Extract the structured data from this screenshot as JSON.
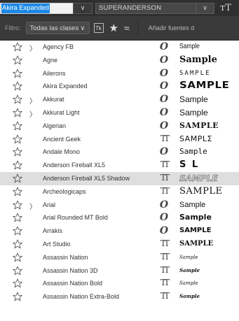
{
  "topbar": {
    "font_name": "Akira Expanded",
    "font_dd_icon": "chevron-down-icon",
    "style_value": "SUPERANDERSON",
    "style_dd_icon": "chevron-down-icon",
    "size_icon": "font-size-icon",
    "dd_glyph": "∨",
    "size_glyph": "тT"
  },
  "filter": {
    "label": "Filtro:",
    "select_value": "Todas las clases",
    "select_glyph": "∨",
    "tk_label": "Tk",
    "star_glyph": "★",
    "approx_glyph": "≈",
    "add_fonts_text": "Añadir fuentes d"
  },
  "fonts": [
    {
      "name": "Agency FB",
      "expandable": true,
      "type": "ot",
      "sample": "Sample"
    },
    {
      "name": "Agne",
      "expandable": false,
      "type": "ot",
      "sample": "Sample"
    },
    {
      "name": "Ailerons",
      "expandable": false,
      "type": "ot",
      "sample": "SAMPLE"
    },
    {
      "name": "Akira Expanded",
      "expandable": false,
      "type": "ot",
      "sample": "SAMPLE"
    },
    {
      "name": "Akkurat",
      "expandable": true,
      "type": "ot",
      "sample": "Sample"
    },
    {
      "name": "Akkurat Light",
      "expandable": true,
      "type": "ot",
      "sample": "Sample"
    },
    {
      "name": "Algerian",
      "expandable": false,
      "type": "ot",
      "sample": "SAMPLE"
    },
    {
      "name": "Ancient Geek",
      "expandable": false,
      "type": "tt",
      "sample": "SAMPLΣ"
    },
    {
      "name": "Andale Mono",
      "expandable": false,
      "type": "ot",
      "sample": "Sample"
    },
    {
      "name": "Anderson Fireball XL5",
      "expandable": false,
      "type": "tt",
      "sample": "S  L"
    },
    {
      "name": "Anderson Fireball XL5 Shadow",
      "expandable": false,
      "type": "tt",
      "sample": "SAMPLE"
    },
    {
      "name": "Archeologicaps",
      "expandable": false,
      "type": "tt",
      "sample": "SAMPLE"
    },
    {
      "name": "Arial",
      "expandable": true,
      "type": "ot",
      "sample": "Sample"
    },
    {
      "name": "Arial Rounded MT Bold",
      "expandable": false,
      "type": "ot",
      "sample": "Sample"
    },
    {
      "name": "Arrakis",
      "expandable": false,
      "type": "ot",
      "sample": "SAMPLE"
    },
    {
      "name": "Art Studio",
      "expandable": false,
      "type": "tt",
      "sample": "SAMPLE"
    },
    {
      "name": "Assassin Nation",
      "expandable": false,
      "type": "tt",
      "sample": "Sample"
    },
    {
      "name": "Assassin Nation 3D",
      "expandable": false,
      "type": "tt",
      "sample": "Sample"
    },
    {
      "name": "Assassin Nation Bold",
      "expandable": false,
      "type": "tt",
      "sample": "Sample"
    },
    {
      "name": "Assassin Nation Extra-Bold",
      "expandable": false,
      "type": "tt",
      "sample": "Sample"
    }
  ],
  "highlighted_index": 10,
  "type_glyphs": {
    "ot": "O",
    "tt": "TT"
  },
  "expander_glyph": "〉",
  "colors": {
    "selection": "#1e88e5",
    "highlight_row": "#dedede",
    "dark_bar": "#2f2f2f",
    "filter_bar": "#3a3a3a"
  }
}
